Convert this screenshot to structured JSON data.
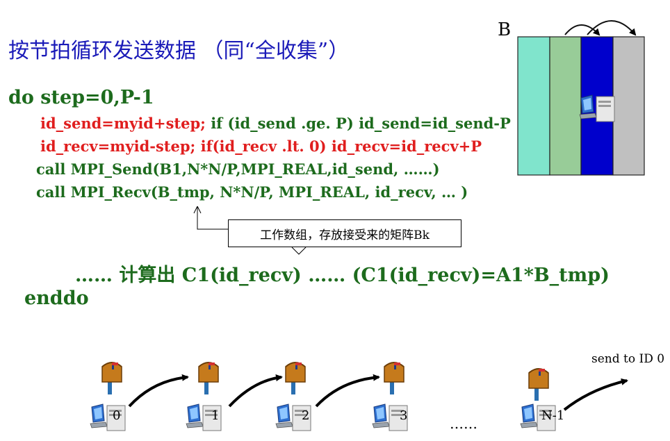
{
  "title": "按节拍循环发送数据 （同“全收集”）",
  "matrix_label": "B",
  "code": {
    "loop_head": "do step=0,P-1",
    "line_send_red": "id_send=myid+step;",
    "line_send_green": " if (id_send .ge. P) id_send=id_send-P",
    "line_recv_red": "id_recv=myid-step; if(id_recv .lt. 0) id_recv=id_recv+P",
    "call_send": "call MPI_Send(B1,N*N/P,MPI_REAL,id_send, ……)",
    "call_recv": "call MPI_Recv(B_tmp,  N*N/P, MPI_REAL, id_recv, … )",
    "compute": "…… 计算出 C1(id_recv) ……  (C1(id_recv)=A1*B_tmp)",
    "loop_end": "enddo"
  },
  "note": "工作数组，存放接受来的矩阵Bk",
  "ring": {
    "send_label": "send to ID 0",
    "ellipsis": "……",
    "nodes": [
      "0",
      "1",
      "2",
      "3",
      "N-1"
    ]
  },
  "colors": {
    "col1": "#80e4cc",
    "col2": "#98cc98",
    "col3": "#0000cc",
    "col4": "#c0c0c0",
    "title": "#1a1ab8",
    "code_green": "#1d6b1d",
    "code_red": "#e01e1e"
  },
  "icons": [
    "computer-icon",
    "mailbox-icon",
    "arrow-icon"
  ]
}
